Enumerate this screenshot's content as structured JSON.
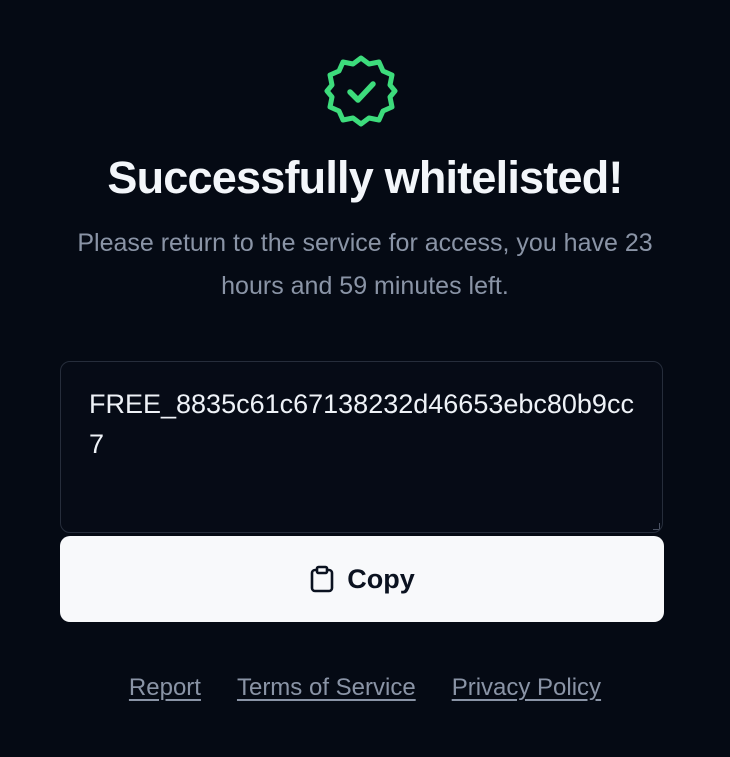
{
  "status": {
    "icon": "verified-badge-check-icon",
    "accent_color": "#3ddc7c",
    "title": "Successfully whitelisted!",
    "message": "Please return to the service for access, you have 23 hours and 59 minutes left."
  },
  "key": {
    "value": "FREE_8835c61c67138232d46653ebc80b9cc7"
  },
  "copy_button": {
    "icon": "clipboard-icon",
    "label": "Copy"
  },
  "footer": {
    "links": [
      {
        "label": "Report"
      },
      {
        "label": "Terms of Service"
      },
      {
        "label": "Privacy Policy"
      }
    ]
  }
}
